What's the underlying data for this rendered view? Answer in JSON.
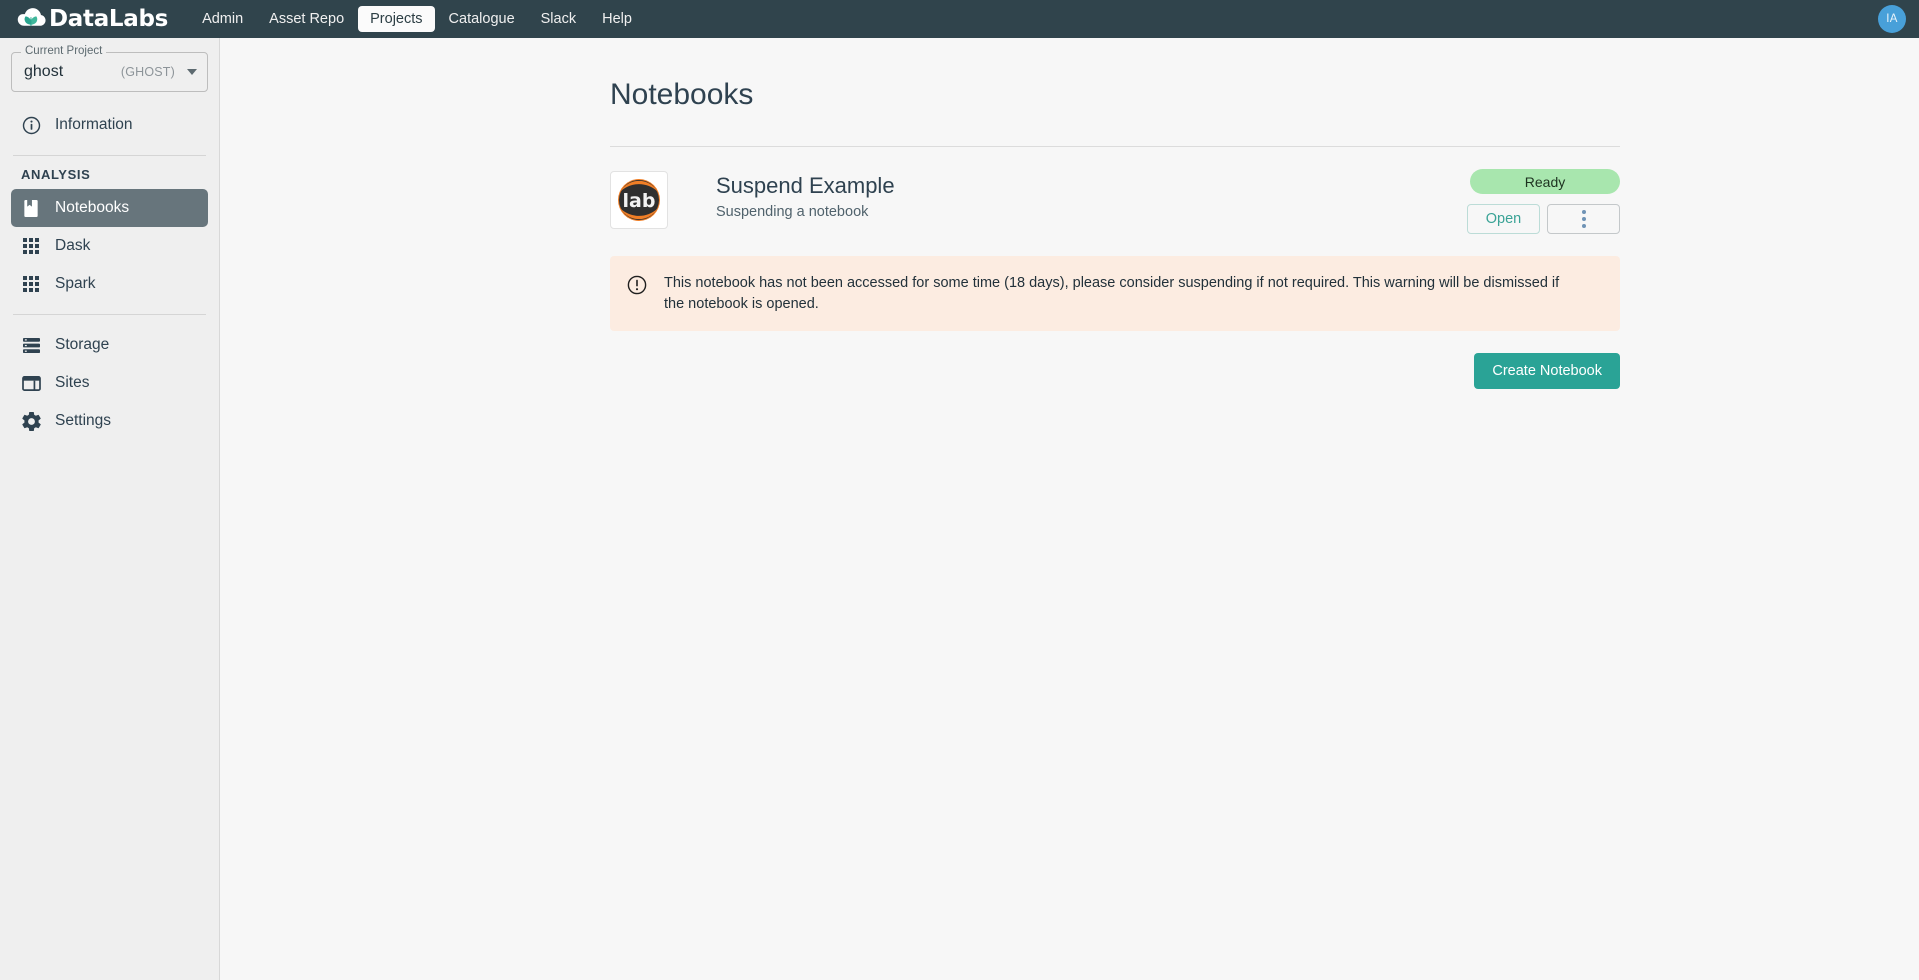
{
  "header": {
    "brand": "DataLabs",
    "brand_icon": "cloud-leaf-logo",
    "nav": [
      {
        "label": "Admin",
        "active": false
      },
      {
        "label": "Asset Repo",
        "active": false
      },
      {
        "label": "Projects",
        "active": true
      },
      {
        "label": "Catalogue",
        "active": false
      },
      {
        "label": "Slack",
        "active": false
      },
      {
        "label": "Help",
        "active": false
      }
    ],
    "avatar_initials": "IA",
    "avatar_color": "#48a0d9",
    "background_color": "#30444c"
  },
  "sidebar": {
    "project": {
      "legend": "Current Project",
      "name": "ghost",
      "code": "(GHOST)"
    },
    "information": {
      "label": "Information",
      "icon": "info-circle-icon"
    },
    "analysis_heading": "ANALYSIS",
    "analysis_items": [
      {
        "label": "Notebooks",
        "icon": "book-icon",
        "active": true
      },
      {
        "label": "Dask",
        "icon": "grid-dots-icon",
        "active": false
      },
      {
        "label": "Spark",
        "icon": "grid-dots-icon",
        "active": false
      }
    ],
    "other_items": [
      {
        "label": "Storage",
        "icon": "storage-icon"
      },
      {
        "label": "Sites",
        "icon": "sites-icon"
      },
      {
        "label": "Settings",
        "icon": "gear-icon"
      }
    ],
    "active_color": "#67757c"
  },
  "main": {
    "title": "Notebooks",
    "notebook": {
      "logo": "jupyterlab-logo",
      "name": "Suspend Example",
      "description": "Suspending a notebook",
      "status": "Ready",
      "status_color": "#a8e6ae",
      "open_label": "Open",
      "more_label": "kebab-menu-icon"
    },
    "alert": {
      "icon": "exclamation-circle-icon",
      "text": "This notebook has not been accessed for some time (18 days), please consider suspending if not required. This warning will be dismissed if the notebook is opened.",
      "background_color": "#fcece1"
    },
    "create_label": "Create Notebook",
    "create_color": "#2aa396"
  }
}
